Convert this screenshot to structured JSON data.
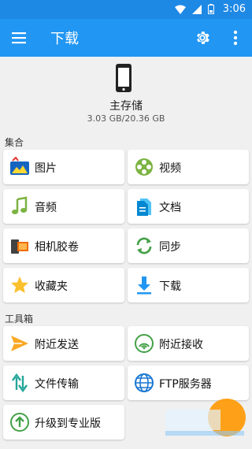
{
  "status_bar": {
    "time": "3:06"
  },
  "app_bar": {
    "title": "下载"
  },
  "storage": {
    "name": "主存储",
    "size": "3.03 GB/20.36 GB"
  },
  "sections": [
    {
      "label": "集合",
      "items": [
        {
          "label": "图片",
          "icon": "pictures-icon"
        },
        {
          "label": "视频",
          "icon": "video-reel-icon"
        },
        {
          "label": "音频",
          "icon": "music-note-icon"
        },
        {
          "label": "文档",
          "icon": "document-icon"
        },
        {
          "label": "相机胶卷",
          "icon": "camera-roll-icon"
        },
        {
          "label": "同步",
          "icon": "sync-icon"
        },
        {
          "label": "收藏夹",
          "icon": "star-icon"
        },
        {
          "label": "下载",
          "icon": "download-icon"
        }
      ]
    },
    {
      "label": "工具箱",
      "items": [
        {
          "label": "附近发送",
          "icon": "send-icon"
        },
        {
          "label": "附近接收",
          "icon": "receive-signal-icon"
        },
        {
          "label": "文件传输",
          "icon": "transfer-icon"
        },
        {
          "label": "FTP服务器",
          "icon": "globe-icon"
        },
        {
          "label": "升级到专业版",
          "icon": "upgrade-icon"
        },
        {
          "label": "",
          "icon": ""
        }
      ]
    }
  ],
  "colors": {
    "primary": "#2196f3",
    "status": "#1e88e5"
  }
}
